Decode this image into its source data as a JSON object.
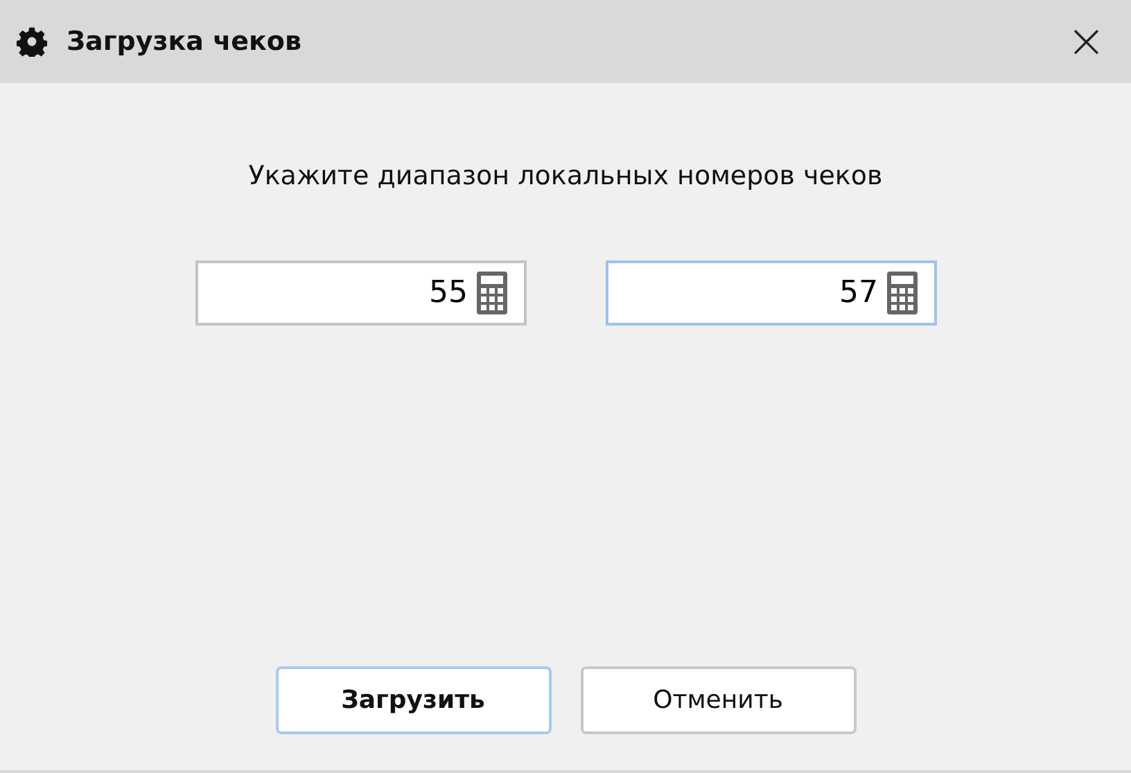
{
  "window": {
    "title": "Загрузка чеков",
    "close": "×"
  },
  "prompt": "Укажите диапазон локальных номеров чеков",
  "fields": [
    {
      "value": "55",
      "focused": false
    },
    {
      "value": "57",
      "focused": true
    }
  ],
  "buttons": [
    {
      "label": "Загрузить",
      "default": true
    },
    {
      "label": "Отменить",
      "default": false
    }
  ]
}
